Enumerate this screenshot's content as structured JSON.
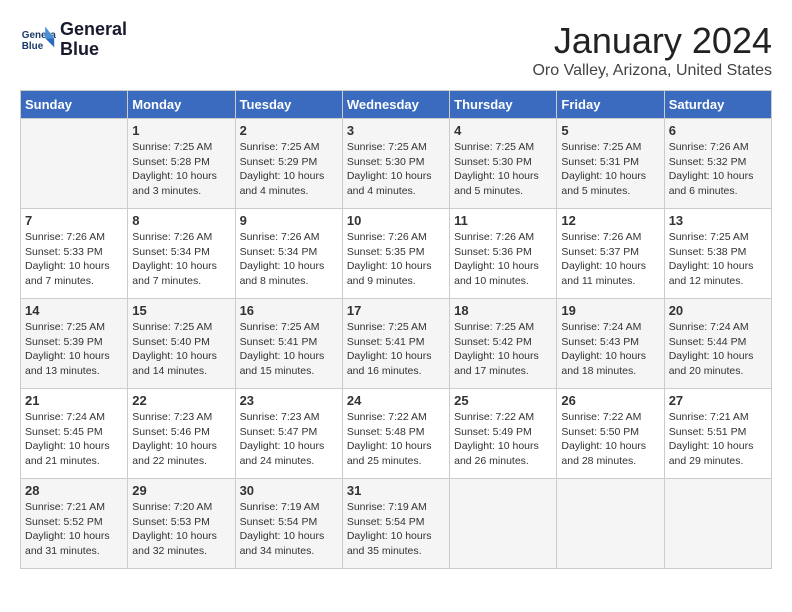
{
  "header": {
    "logo_line1": "General",
    "logo_line2": "Blue",
    "month": "January 2024",
    "location": "Oro Valley, Arizona, United States"
  },
  "days_of_week": [
    "Sunday",
    "Monday",
    "Tuesday",
    "Wednesday",
    "Thursday",
    "Friday",
    "Saturday"
  ],
  "weeks": [
    [
      {
        "day": "",
        "info": ""
      },
      {
        "day": "1",
        "info": "Sunrise: 7:25 AM\nSunset: 5:28 PM\nDaylight: 10 hours\nand 3 minutes."
      },
      {
        "day": "2",
        "info": "Sunrise: 7:25 AM\nSunset: 5:29 PM\nDaylight: 10 hours\nand 4 minutes."
      },
      {
        "day": "3",
        "info": "Sunrise: 7:25 AM\nSunset: 5:30 PM\nDaylight: 10 hours\nand 4 minutes."
      },
      {
        "day": "4",
        "info": "Sunrise: 7:25 AM\nSunset: 5:30 PM\nDaylight: 10 hours\nand 5 minutes."
      },
      {
        "day": "5",
        "info": "Sunrise: 7:25 AM\nSunset: 5:31 PM\nDaylight: 10 hours\nand 5 minutes."
      },
      {
        "day": "6",
        "info": "Sunrise: 7:26 AM\nSunset: 5:32 PM\nDaylight: 10 hours\nand 6 minutes."
      }
    ],
    [
      {
        "day": "7",
        "info": "Sunrise: 7:26 AM\nSunset: 5:33 PM\nDaylight: 10 hours\nand 7 minutes."
      },
      {
        "day": "8",
        "info": "Sunrise: 7:26 AM\nSunset: 5:34 PM\nDaylight: 10 hours\nand 7 minutes."
      },
      {
        "day": "9",
        "info": "Sunrise: 7:26 AM\nSunset: 5:34 PM\nDaylight: 10 hours\nand 8 minutes."
      },
      {
        "day": "10",
        "info": "Sunrise: 7:26 AM\nSunset: 5:35 PM\nDaylight: 10 hours\nand 9 minutes."
      },
      {
        "day": "11",
        "info": "Sunrise: 7:26 AM\nSunset: 5:36 PM\nDaylight: 10 hours\nand 10 minutes."
      },
      {
        "day": "12",
        "info": "Sunrise: 7:26 AM\nSunset: 5:37 PM\nDaylight: 10 hours\nand 11 minutes."
      },
      {
        "day": "13",
        "info": "Sunrise: 7:25 AM\nSunset: 5:38 PM\nDaylight: 10 hours\nand 12 minutes."
      }
    ],
    [
      {
        "day": "14",
        "info": "Sunrise: 7:25 AM\nSunset: 5:39 PM\nDaylight: 10 hours\nand 13 minutes."
      },
      {
        "day": "15",
        "info": "Sunrise: 7:25 AM\nSunset: 5:40 PM\nDaylight: 10 hours\nand 14 minutes."
      },
      {
        "day": "16",
        "info": "Sunrise: 7:25 AM\nSunset: 5:41 PM\nDaylight: 10 hours\nand 15 minutes."
      },
      {
        "day": "17",
        "info": "Sunrise: 7:25 AM\nSunset: 5:41 PM\nDaylight: 10 hours\nand 16 minutes."
      },
      {
        "day": "18",
        "info": "Sunrise: 7:25 AM\nSunset: 5:42 PM\nDaylight: 10 hours\nand 17 minutes."
      },
      {
        "day": "19",
        "info": "Sunrise: 7:24 AM\nSunset: 5:43 PM\nDaylight: 10 hours\nand 18 minutes."
      },
      {
        "day": "20",
        "info": "Sunrise: 7:24 AM\nSunset: 5:44 PM\nDaylight: 10 hours\nand 20 minutes."
      }
    ],
    [
      {
        "day": "21",
        "info": "Sunrise: 7:24 AM\nSunset: 5:45 PM\nDaylight: 10 hours\nand 21 minutes."
      },
      {
        "day": "22",
        "info": "Sunrise: 7:23 AM\nSunset: 5:46 PM\nDaylight: 10 hours\nand 22 minutes."
      },
      {
        "day": "23",
        "info": "Sunrise: 7:23 AM\nSunset: 5:47 PM\nDaylight: 10 hours\nand 24 minutes."
      },
      {
        "day": "24",
        "info": "Sunrise: 7:22 AM\nSunset: 5:48 PM\nDaylight: 10 hours\nand 25 minutes."
      },
      {
        "day": "25",
        "info": "Sunrise: 7:22 AM\nSunset: 5:49 PM\nDaylight: 10 hours\nand 26 minutes."
      },
      {
        "day": "26",
        "info": "Sunrise: 7:22 AM\nSunset: 5:50 PM\nDaylight: 10 hours\nand 28 minutes."
      },
      {
        "day": "27",
        "info": "Sunrise: 7:21 AM\nSunset: 5:51 PM\nDaylight: 10 hours\nand 29 minutes."
      }
    ],
    [
      {
        "day": "28",
        "info": "Sunrise: 7:21 AM\nSunset: 5:52 PM\nDaylight: 10 hours\nand 31 minutes."
      },
      {
        "day": "29",
        "info": "Sunrise: 7:20 AM\nSunset: 5:53 PM\nDaylight: 10 hours\nand 32 minutes."
      },
      {
        "day": "30",
        "info": "Sunrise: 7:19 AM\nSunset: 5:54 PM\nDaylight: 10 hours\nand 34 minutes."
      },
      {
        "day": "31",
        "info": "Sunrise: 7:19 AM\nSunset: 5:54 PM\nDaylight: 10 hours\nand 35 minutes."
      },
      {
        "day": "",
        "info": ""
      },
      {
        "day": "",
        "info": ""
      },
      {
        "day": "",
        "info": ""
      }
    ]
  ]
}
